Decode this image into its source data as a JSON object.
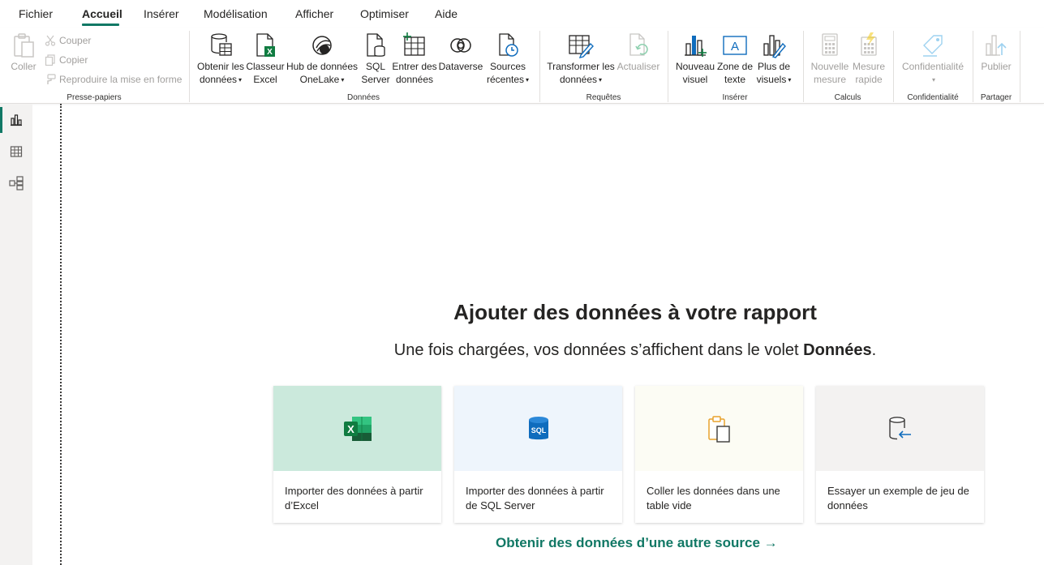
{
  "menu": {
    "tabs": [
      {
        "label": "Fichier"
      },
      {
        "label": "Accueil"
      },
      {
        "label": "Insérer"
      },
      {
        "label": "Modélisation"
      },
      {
        "label": "Afficher"
      },
      {
        "label": "Optimiser"
      },
      {
        "label": "Aide"
      }
    ],
    "active": "Accueil"
  },
  "ribbon": {
    "clipboard": {
      "group_label": "Presse-papiers",
      "paste": "Coller",
      "cut": "Couper",
      "copy": "Copier",
      "format_painter": "Reproduire la mise en forme"
    },
    "data": {
      "group_label": "Données",
      "get_data": [
        "Obtenir les",
        "données"
      ],
      "excel": [
        "Classeur",
        "Excel"
      ],
      "onelake": [
        "Hub de données",
        "OneLake"
      ],
      "sql": [
        "SQL",
        "Server"
      ],
      "enter_data": [
        "Entrer des",
        "données"
      ],
      "dataverse": "Dataverse",
      "recent": [
        "Sources",
        "récentes"
      ]
    },
    "queries": {
      "group_label": "Requêtes",
      "transform": [
        "Transformer les",
        "données"
      ],
      "refresh": "Actualiser"
    },
    "insert": {
      "group_label": "Insérer",
      "new_visual": [
        "Nouveau",
        "visuel"
      ],
      "textbox": [
        "Zone de",
        "texte"
      ],
      "more_visuals": [
        "Plus de",
        "visuels"
      ]
    },
    "calculations": {
      "group_label": "Calculs",
      "new_measure": [
        "Nouvelle",
        "mesure"
      ],
      "quick_measure": [
        "Mesure",
        "rapide"
      ]
    },
    "sensitivity": {
      "group_label": "Confidentialité",
      "label": "Confidentialité"
    },
    "share": {
      "group_label": "Partager",
      "publish": "Publier"
    }
  },
  "main": {
    "title": "Ajouter des données à votre rapport",
    "subtitle_prefix": "Une fois chargées, vos données s’affichent dans le volet ",
    "subtitle_bold": "Données",
    "subtitle_suffix": ".",
    "cards": [
      {
        "label": "Importer des données à partir d’Excel",
        "bg": "#cbe9dc"
      },
      {
        "label": "Importer des données à partir de SQL Server",
        "bg": "#eef5fc"
      },
      {
        "label": "Coller les données dans une table vide",
        "bg": "#fcfcf4"
      },
      {
        "label": "Essayer un exemple de jeu de données",
        "bg": "#f3f2f1"
      }
    ],
    "other_source": "Obtenir des données d’une autre source →"
  },
  "colors": {
    "accent": "#117865",
    "disabled_text": "#a19f9d"
  }
}
